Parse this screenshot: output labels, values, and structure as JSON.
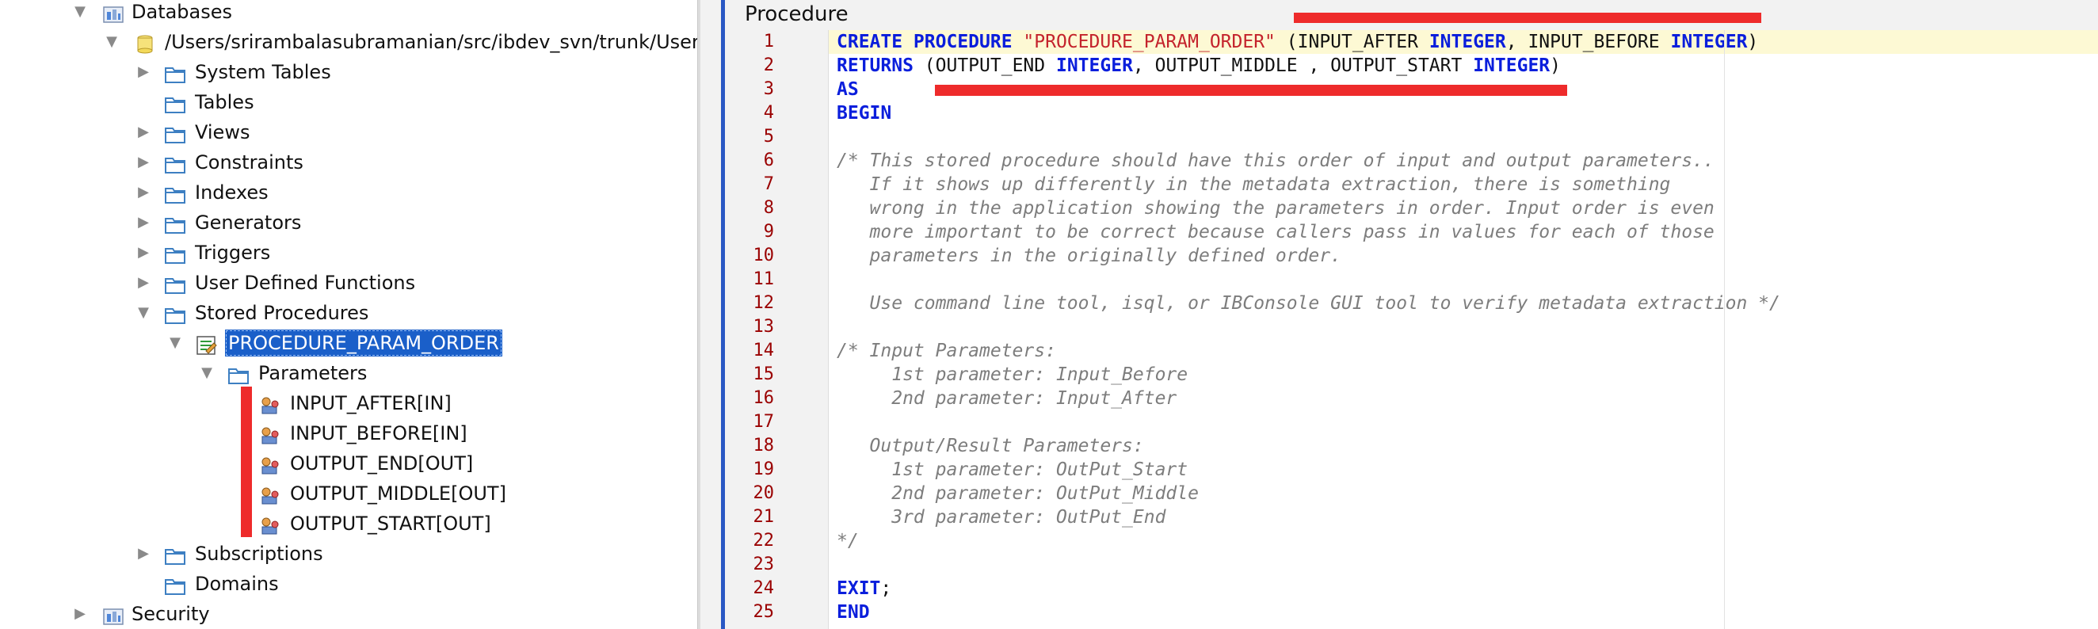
{
  "colors": {
    "selection": "#1a5fc9",
    "keyword": "#0a1edc",
    "string": "#c4232c",
    "comment": "#7d7d7d",
    "line_number": "#9a0000",
    "redaction": "#ee2b2b",
    "panel_border": "#2a58c4"
  },
  "tree": {
    "databases": "Databases",
    "db_path": "/Users/srirambalasubramanian/src/ibdev_svn/trunk/User",
    "system_tables": "System Tables",
    "tables": "Tables",
    "views": "Views",
    "constraints": "Constraints",
    "indexes": "Indexes",
    "generators": "Generators",
    "triggers": "Triggers",
    "udfs": "User Defined Functions",
    "stored_procedures": "Stored Procedures",
    "procedure": "PROCEDURE_PARAM_ORDER",
    "parameters": "Parameters",
    "params": [
      "INPUT_AFTER[IN]",
      "INPUT_BEFORE[IN]",
      "OUTPUT_END[OUT]",
      "OUTPUT_MIDDLE[OUT]",
      "OUTPUT_START[OUT]"
    ],
    "subscriptions": "Subscriptions",
    "domains": "Domains",
    "security": "Security"
  },
  "editor": {
    "title": "Procedure",
    "line_numbers": [
      "1",
      "2",
      "3",
      "4",
      "5",
      "6",
      "7",
      "8",
      "9",
      "10",
      "11",
      "12",
      "13",
      "14",
      "15",
      "16",
      "17",
      "18",
      "19",
      "20",
      "21",
      "22",
      "23",
      "24",
      "25"
    ],
    "code": {
      "l1_kw1": "CREATE PROCEDURE",
      "l1_str": "\"PROCEDURE_PARAM_ORDER\"",
      "l1_t1": "(INPUT_AFTER",
      "l1_kw2": "INTEGER",
      "l1_t2": ", INPUT_BEFORE",
      "l1_kw3": "INTEGER",
      "l1_t3": ")",
      "l2_kw1": "RETURNS",
      "l2_t1": "(OUTPUT_END",
      "l2_kw2": "INTEGER",
      "l2_t2": ", OUTPUT_MIDDLE , OUTPUT_START",
      "l2_kw3": "INTEGER",
      "l2_t3": ")",
      "l3": "AS",
      "l4": "BEGIN",
      "l6": "/* This stored procedure should have this order of input and output parameters..",
      "l7": "   If it shows up differently in the metadata extraction, there is something",
      "l8": "   wrong in the application showing the parameters in order. Input order is even",
      "l9": "   more important to be correct because callers pass in values for each of those",
      "l10": "   parameters in the originally defined order.",
      "l12": "   Use command line tool, isql, or IBConsole GUI tool to verify metadata extraction */",
      "l14": "/* Input Parameters:",
      "l15": "     1st parameter: Input_Before",
      "l16": "     2nd parameter: Input_After",
      "l18": "   Output/Result Parameters:",
      "l19": "     1st parameter: OutPut_Start",
      "l20": "     2nd parameter: OutPut_Middle",
      "l21": "     3rd parameter: OutPut_End",
      "l22": "*/",
      "l24_kw": "EXIT",
      "l24_t": ";",
      "l25": "END"
    }
  }
}
